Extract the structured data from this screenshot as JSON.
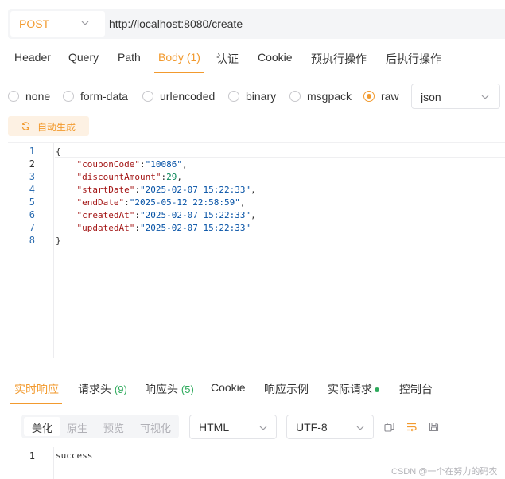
{
  "url_bar": {
    "method": "POST",
    "url": "http://localhost:8080/create"
  },
  "request_tabs": [
    {
      "label": "Header"
    },
    {
      "label": "Query"
    },
    {
      "label": "Path"
    },
    {
      "label": "Body",
      "count": "(1)",
      "active": true
    },
    {
      "label": "认证"
    },
    {
      "label": "Cookie"
    },
    {
      "label": "预执行操作"
    },
    {
      "label": "后执行操作"
    }
  ],
  "body_types": {
    "options": [
      "none",
      "form-data",
      "urlencoded",
      "binary",
      "msgpack",
      "raw"
    ],
    "selected": "raw",
    "format": "json"
  },
  "auto_generate": {
    "label": "自动生成",
    "icon": "refresh-icon"
  },
  "editor": {
    "line_numbers": [
      "1",
      "2",
      "3",
      "4",
      "5",
      "6",
      "7",
      "8"
    ],
    "active_line": 2,
    "lines": [
      [
        {
          "t": "p",
          "v": "{"
        }
      ],
      [
        {
          "t": "p",
          "v": "    "
        },
        {
          "t": "k",
          "v": "\"couponCode\""
        },
        {
          "t": "p",
          "v": ":"
        },
        {
          "t": "s",
          "v": "\"10086\""
        },
        {
          "t": "p",
          "v": ","
        }
      ],
      [
        {
          "t": "p",
          "v": "    "
        },
        {
          "t": "k",
          "v": "\"discountAmount\""
        },
        {
          "t": "p",
          "v": ":"
        },
        {
          "t": "n",
          "v": "29"
        },
        {
          "t": "p",
          "v": ","
        }
      ],
      [
        {
          "t": "p",
          "v": "    "
        },
        {
          "t": "k",
          "v": "\"startDate\""
        },
        {
          "t": "p",
          "v": ":"
        },
        {
          "t": "s",
          "v": "\"2025-02-07 15:22:33\""
        },
        {
          "t": "p",
          "v": ","
        }
      ],
      [
        {
          "t": "p",
          "v": "    "
        },
        {
          "t": "k",
          "v": "\"endDate\""
        },
        {
          "t": "p",
          "v": ":"
        },
        {
          "t": "s",
          "v": "\"2025-05-12 22:58:59\""
        },
        {
          "t": "p",
          "v": ","
        }
      ],
      [
        {
          "t": "p",
          "v": "    "
        },
        {
          "t": "k",
          "v": "\"createdAt\""
        },
        {
          "t": "p",
          "v": ":"
        },
        {
          "t": "s",
          "v": "\"2025-02-07 15:22:33\""
        },
        {
          "t": "p",
          "v": ","
        }
      ],
      [
        {
          "t": "p",
          "v": "    "
        },
        {
          "t": "k",
          "v": "\"updatedAt\""
        },
        {
          "t": "p",
          "v": ":"
        },
        {
          "t": "s",
          "v": "\"2025-02-07 15:22:33\""
        }
      ],
      [
        {
          "t": "p",
          "v": "}"
        }
      ]
    ]
  },
  "response_tabs": [
    {
      "label": "实时响应",
      "active": true
    },
    {
      "label": "请求头",
      "count": "(9)"
    },
    {
      "label": "响应头",
      "count": "(5)"
    },
    {
      "label": "Cookie"
    },
    {
      "label": "响应示例"
    },
    {
      "label": "实际请求",
      "dot": true
    },
    {
      "label": "控制台"
    }
  ],
  "response_view": {
    "modes": [
      "美化",
      "原生",
      "预览",
      "可视化"
    ],
    "active_mode": "美化",
    "type": "HTML",
    "encoding": "UTF-8",
    "tools": [
      "copy-icon",
      "wrap-icon",
      "save-icon"
    ]
  },
  "response_body": {
    "line_number": "1",
    "text": "success"
  },
  "watermark": "CSDN @一个在努力的码农",
  "colors": {
    "accent": "#f29a2e",
    "count_green": "#2eaa5c",
    "line_number_blue": "#2b6cb0",
    "json_key": "#a31515",
    "json_string": "#0451a5",
    "json_number": "#098658"
  }
}
